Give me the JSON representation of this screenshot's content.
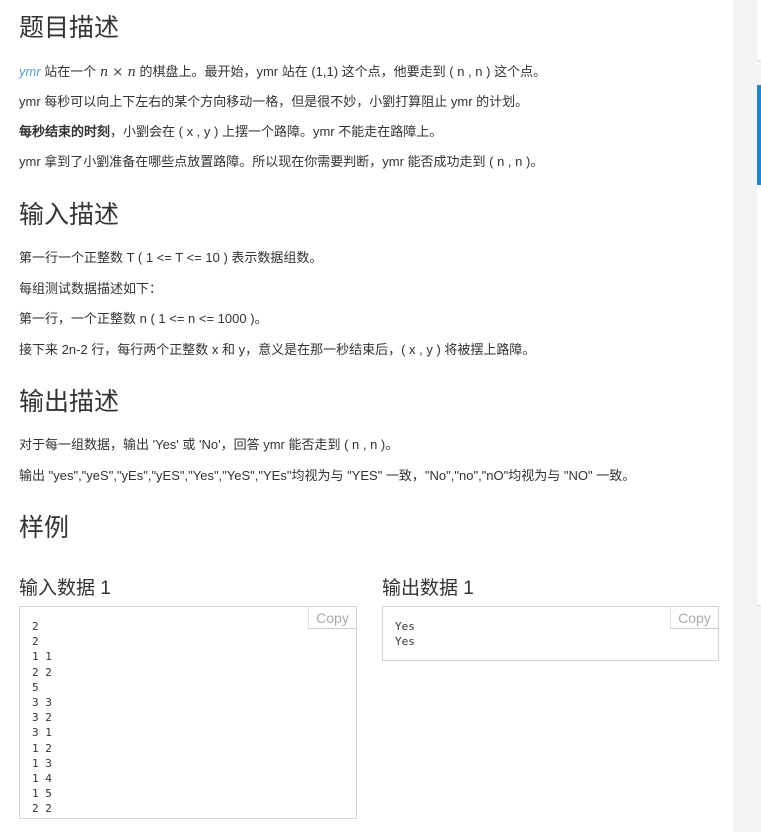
{
  "sections": {
    "description": {
      "title": "题目描述",
      "p1": {
        "name": "ymr",
        "t1": " 站在一个 ",
        "math_n1": "n",
        "math_x": " × ",
        "math_n2": "n",
        "t2": " 的棋盘上。最开始，ymr 站在 (1,1) 这个点，他要走到 ( n , n ) 这个点。"
      },
      "p2": "ymr 每秒可以向上下左右的某个方向移动一格，但是很不妙，小劉打算阻止 ymr 的计划。",
      "p3": {
        "bold": "每秒结束的时刻",
        "rest": "，小劉会在 ( x , y ) 上摆一个路障。ymr 不能走在路障上。"
      },
      "p4": "ymr 拿到了小劉准备在哪些点放置路障。所以现在你需要判断，ymr 能否成功走到 ( n , n )。"
    },
    "input": {
      "title": "输入描述",
      "p1": "第一行一个正整数 T ( 1 <= T <= 10 ) 表示数据组数。",
      "p2": "每组测试数据描述如下：",
      "p3": "第一行，一个正整数 n ( 1 <= n <= 1000 )。",
      "p4": "接下来 2n-2 行，每行两个正整数 x 和 y，意义是在那一秒结束后，( x , y ) 将被摆上路障。"
    },
    "output": {
      "title": "输出描述",
      "p1": "对于每一组数据，输出 'Yes' 或 'No'，回答 ymr 能否走到 ( n , n )。",
      "p2": "输出 \"yes\",\"yeS\",\"yEs\",\"yES\",\"Yes\",\"YeS\",\"YEs\"均视为与 \"YES\" 一致，\"No\",\"no\",\"nO\"均视为与 \"NO\" 一致。"
    },
    "sample": {
      "title": "样例",
      "input_title": "输入数据 1",
      "output_title": "输出数据 1",
      "input_data": "2\n2\n1 1\n2 2\n5\n3 3\n3 2\n3 1\n1 2\n1 3\n1 4\n1 5\n2 2",
      "output_data": "Yes\nYes",
      "copy_label": "Copy"
    }
  }
}
